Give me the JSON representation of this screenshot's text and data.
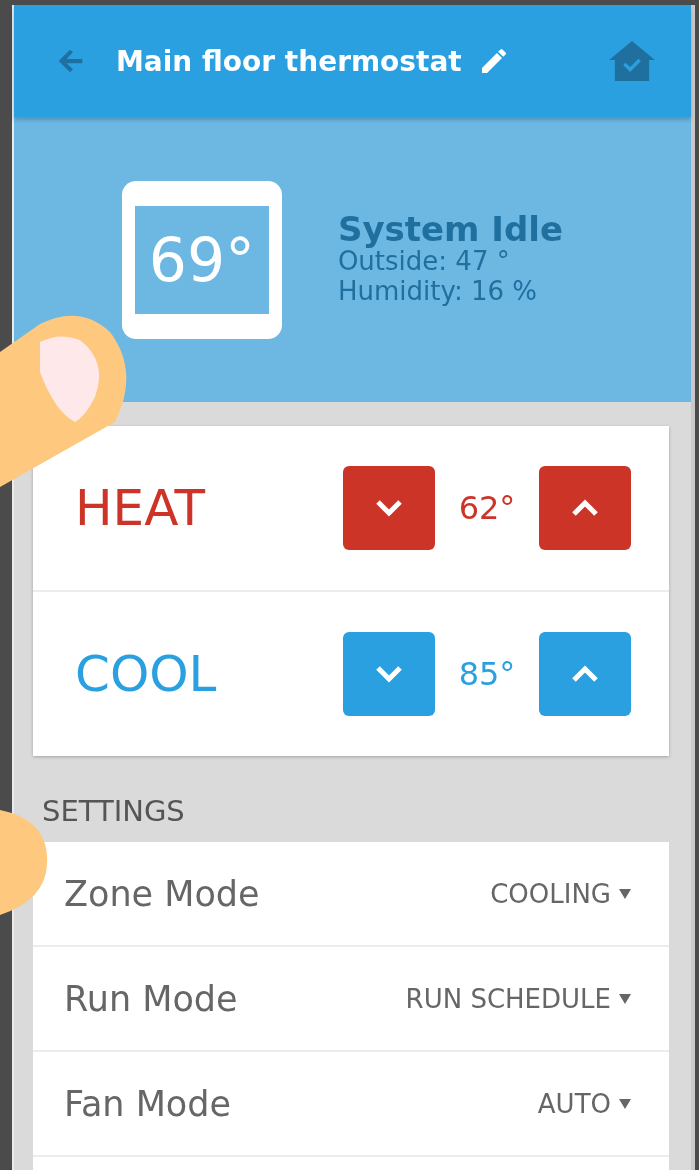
{
  "header": {
    "title": "Main floor thermostat"
  },
  "status": {
    "temperature": "69°",
    "state": "System Idle",
    "outside": "Outside: 47 °",
    "humidity": "Humidity: 16 %"
  },
  "setpoints": [
    {
      "kind": "heat",
      "label": "HEAT",
      "value": "62°"
    },
    {
      "kind": "cool",
      "label": "COOL",
      "value": "85°"
    }
  ],
  "settings": {
    "heading": "SETTINGS",
    "rows": [
      {
        "label": "Zone Mode",
        "value": "COOLING"
      },
      {
        "label": "Run Mode",
        "value": "RUN SCHEDULE"
      },
      {
        "label": "Fan Mode",
        "value": "AUTO"
      }
    ]
  }
}
